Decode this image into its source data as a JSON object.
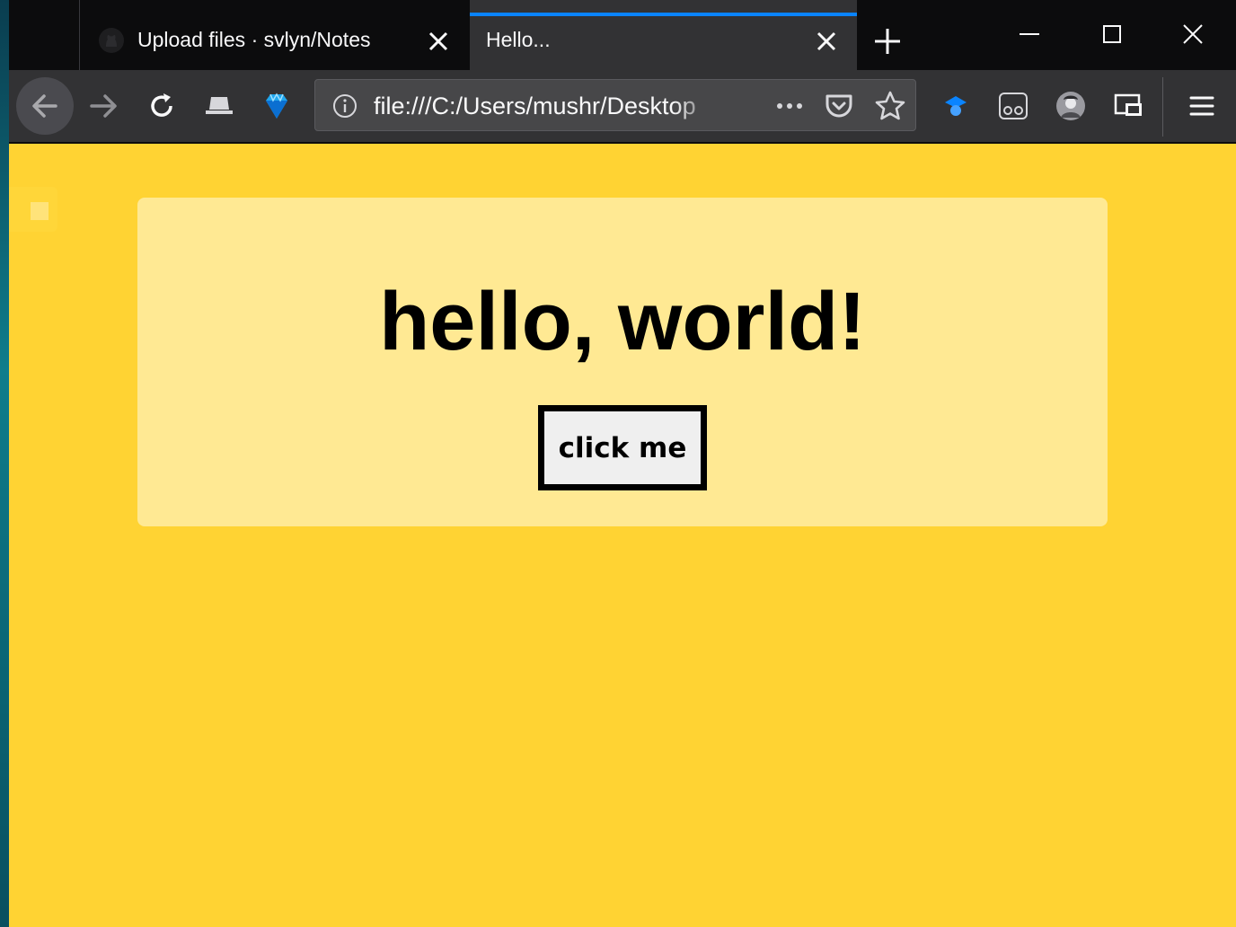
{
  "browser": {
    "tabs": [
      {
        "title": "Upload files · svlyn/Notes",
        "favicon": "github-icon",
        "active": false
      },
      {
        "title": "Hello...",
        "active": true
      }
    ],
    "url": "file:///C:/Users/mushr/Desktop"
  },
  "page": {
    "heading": "hello, world!",
    "button_label": "click me"
  },
  "colors": {
    "page_background": "#ffd333",
    "card_background": "#ffe993",
    "active_tab_accent": "#0a84ff"
  }
}
